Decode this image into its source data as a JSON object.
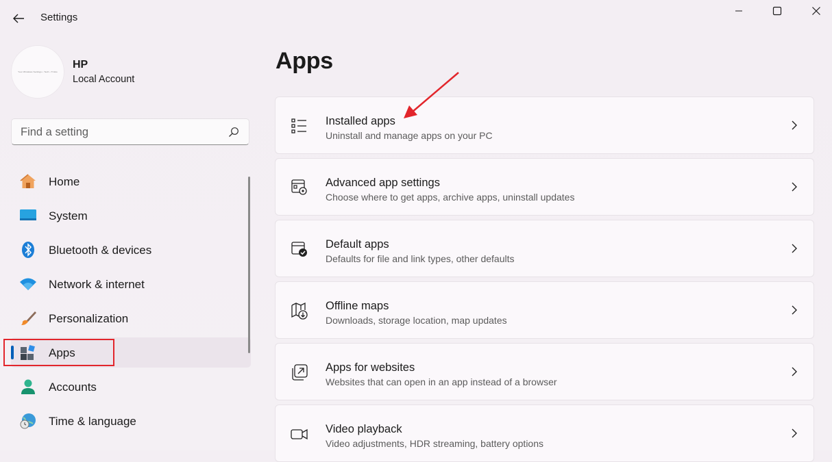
{
  "window": {
    "title": "Settings"
  },
  "profile": {
    "name": "HP",
    "account": "Local Account",
    "avatar_text": "Your Windows Settings • Tech • Tricks"
  },
  "search": {
    "placeholder": "Find a setting"
  },
  "sidebar": {
    "items": [
      {
        "label": "Home",
        "icon": "home-icon"
      },
      {
        "label": "System",
        "icon": "system-icon"
      },
      {
        "label": "Bluetooth & devices",
        "icon": "bluetooth-icon"
      },
      {
        "label": "Network & internet",
        "icon": "wifi-icon"
      },
      {
        "label": "Personalization",
        "icon": "brush-icon"
      },
      {
        "label": "Apps",
        "icon": "apps-icon",
        "selected": true
      },
      {
        "label": "Accounts",
        "icon": "person-icon"
      },
      {
        "label": "Time & language",
        "icon": "globe-clock-icon"
      }
    ]
  },
  "main": {
    "title": "Apps",
    "cards": [
      {
        "title": "Installed apps",
        "subtitle": "Uninstall and manage apps on your PC",
        "icon": "list-icon"
      },
      {
        "title": "Advanced app settings",
        "subtitle": "Choose where to get apps, archive apps, uninstall updates",
        "icon": "app-settings-icon"
      },
      {
        "title": "Default apps",
        "subtitle": "Defaults for file and link types, other defaults",
        "icon": "default-apps-icon"
      },
      {
        "title": "Offline maps",
        "subtitle": "Downloads, storage location, map updates",
        "icon": "map-download-icon"
      },
      {
        "title": "Apps for websites",
        "subtitle": "Websites that can open in an app instead of a browser",
        "icon": "open-in-app-icon"
      },
      {
        "title": "Video playback",
        "subtitle": "Video adjustments, HDR streaming, battery options",
        "icon": "video-camera-icon"
      }
    ]
  },
  "colors": {
    "accent": "#005fb8",
    "annotation": "#e2252b"
  }
}
